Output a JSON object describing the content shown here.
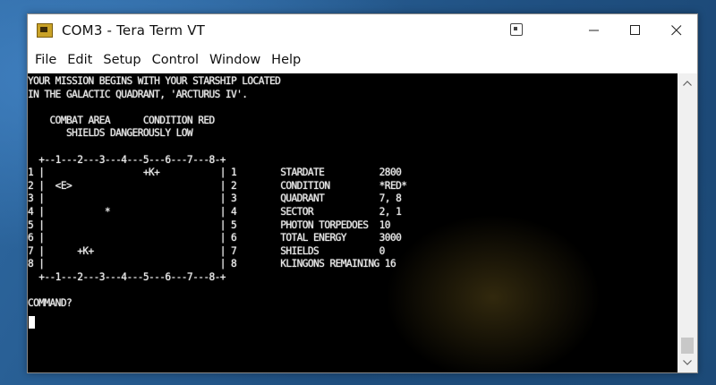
{
  "window": {
    "title": "COM3 - Tera Term VT",
    "icon": "teraterm-app-icon"
  },
  "menu": {
    "items": [
      "File",
      "Edit",
      "Setup",
      "Control",
      "Window",
      "Help"
    ]
  },
  "terminal": {
    "lines": [
      "YOUR MISSION BEGINS WITH YOUR STARSHIP LOCATED",
      "IN THE GALACTIC QUADRANT, 'ARCTURUS IV'.",
      "",
      "    COMBAT AREA      CONDITION RED",
      "       SHIELDS DANGEROUSLY LOW",
      "",
      "  +--1---2---3---4---5---6---7---8-+",
      "1 |                  +K+           | 1        STARDATE          2800",
      "2 |  <E>                           | 2        CONDITION         *RED*",
      "3 |                                | 3        QUADRANT          7, 8",
      "4 |           *                    | 4        SECTOR            2, 1",
      "5 |                                | 5        PHOTON TORPEDOES  10",
      "6 |                                | 6        TOTAL ENERGY      3000",
      "7 |      +K+                       | 7        SHIELDS           0",
      "8 |                                | 8        KLINGONS REMAINING 16",
      "  +--1---2---3---4---5---6---7---8-+",
      "",
      "COMMAND?"
    ]
  },
  "colors": {
    "terminal_bg": "#000000",
    "terminal_fg": "#e8e8e8",
    "titlebar_bg": "#ffffff"
  }
}
